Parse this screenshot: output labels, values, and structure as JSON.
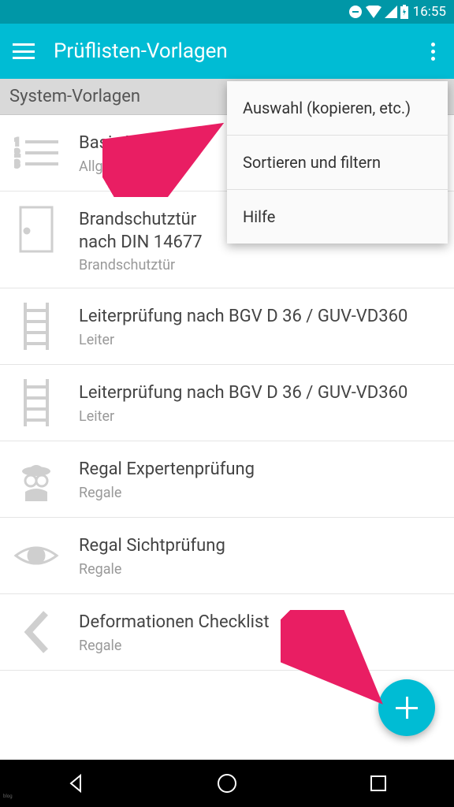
{
  "status": {
    "time": "16:55"
  },
  "app_bar": {
    "title": "Prüflisten-Vorlagen"
  },
  "section": {
    "header": "System-Vorlagen"
  },
  "items": [
    {
      "title": "Basis-Vorlage",
      "sub": "Allgemein",
      "icon": "list"
    },
    {
      "title": "Brandschutztür\nnach DIN 14677",
      "sub": "Brandschutztür",
      "icon": "door"
    },
    {
      "title": "Leiterprüfung nach BGV D 36 / GUV-VD360",
      "sub": "Leiter",
      "icon": "ladder"
    },
    {
      "title": "Leiterprüfung nach BGV D 36 / GUV-VD360",
      "sub": "Leiter",
      "icon": "ladder"
    },
    {
      "title": "Regal Expertenprüfung",
      "sub": "Regale",
      "icon": "spy"
    },
    {
      "title": "Regal Sichtprüfung",
      "sub": "Regale",
      "icon": "eye"
    },
    {
      "title": "Deformationen Checklist",
      "sub": "Regale",
      "icon": "chevron"
    }
  ],
  "menu": [
    "Auswahl (kopieren, etc.)",
    "Sortieren und filtern",
    "Hilfe"
  ],
  "watermark": "blog"
}
